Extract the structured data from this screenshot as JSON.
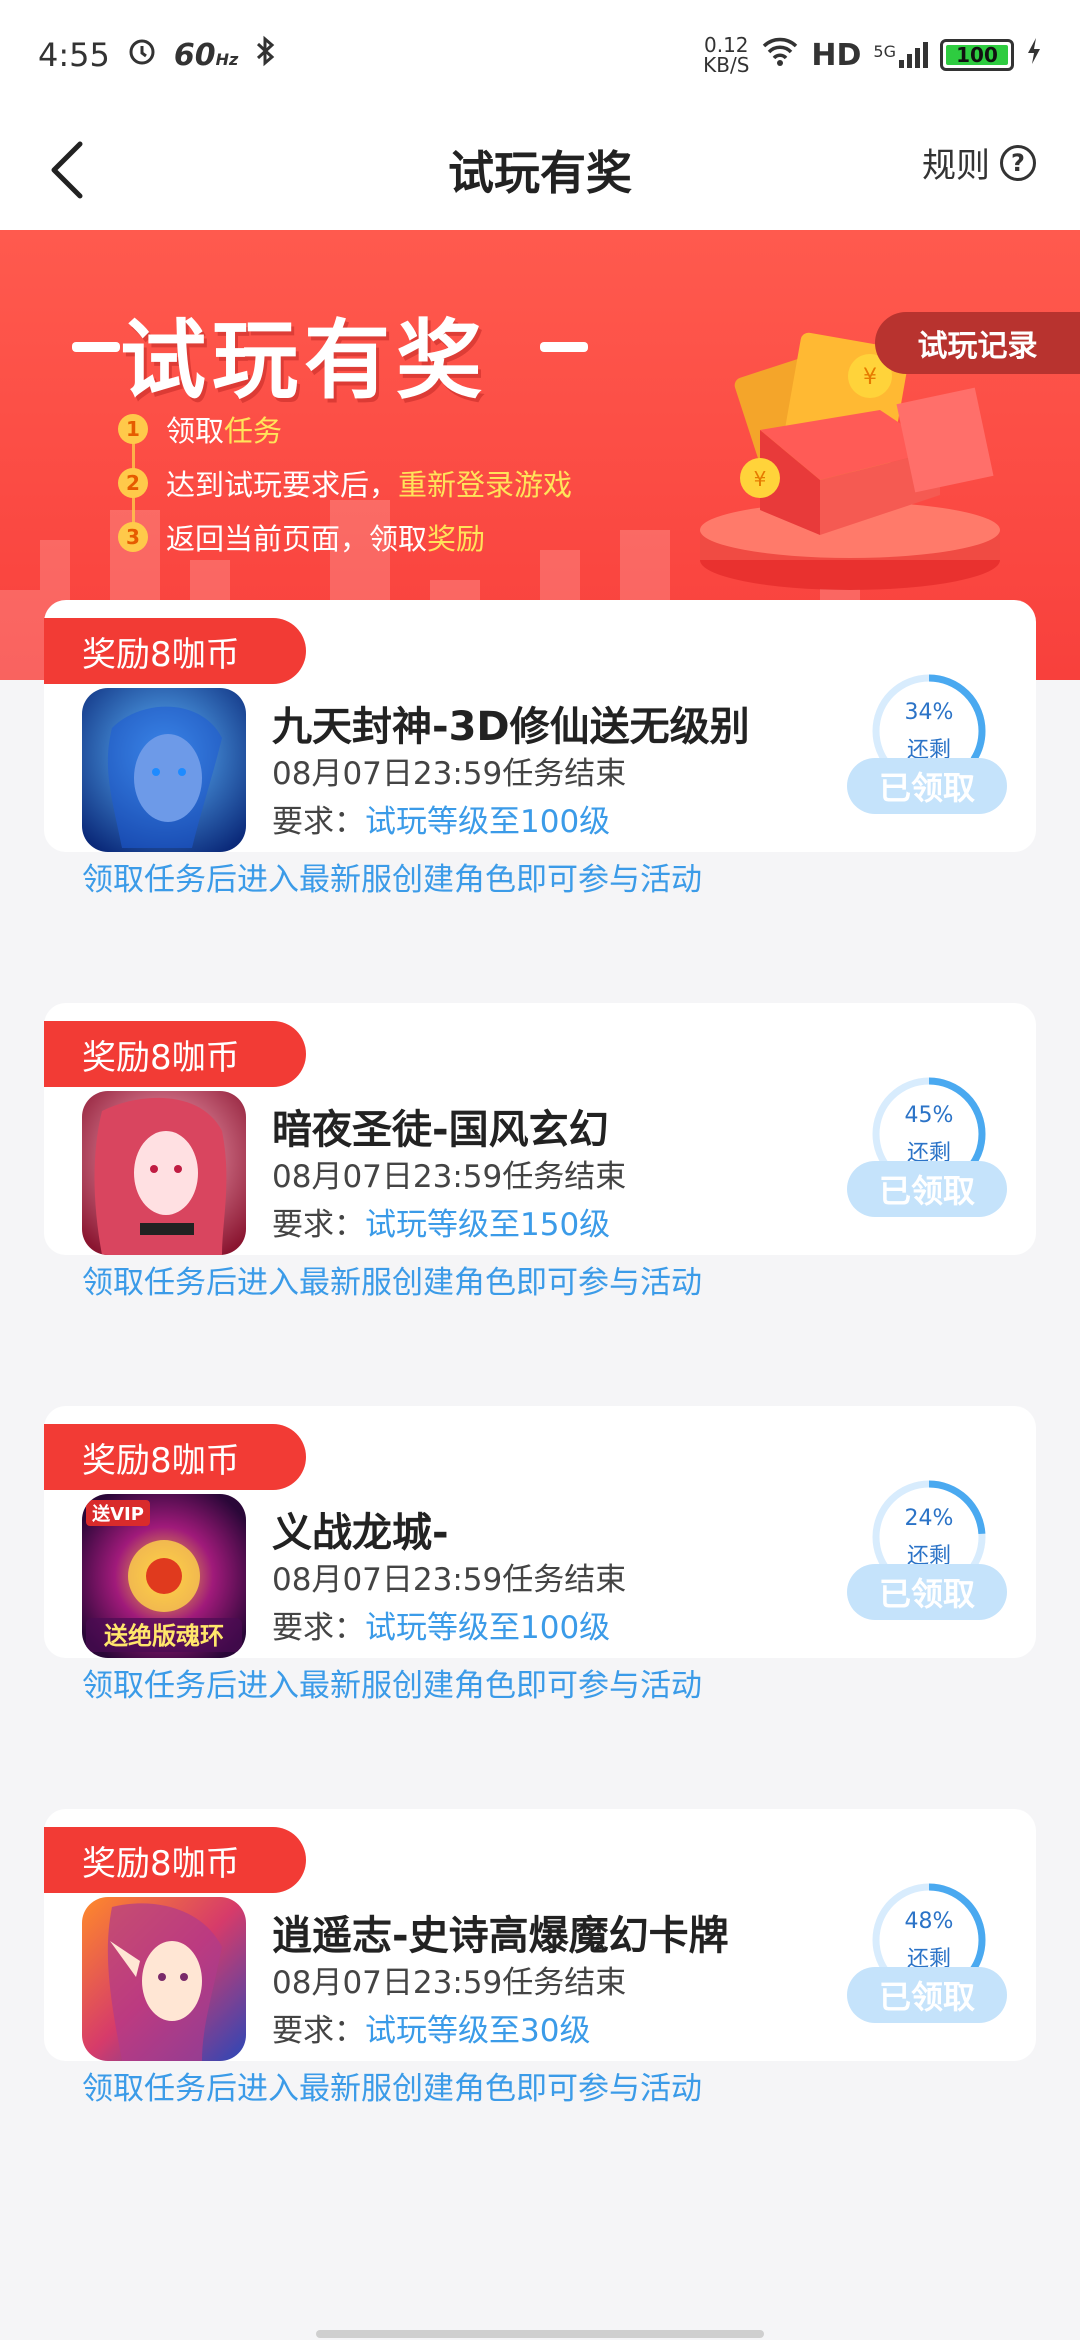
{
  "status_bar": {
    "time": "4:55",
    "refresh": "60",
    "refresh_unit": "Hz",
    "net_speed_value": "0.12",
    "net_speed_unit": "KB/S",
    "hd": "HD",
    "network": "5G",
    "battery": "100"
  },
  "header": {
    "title": "试玩有奖",
    "rules_label": "规则",
    "help_symbol": "?"
  },
  "banner": {
    "title": "试玩有奖",
    "record_button": "试玩记录",
    "steps": [
      {
        "num": "1",
        "text": "领取",
        "highlight": "任务"
      },
      {
        "num": "2",
        "text": "达到试玩要求后，",
        "highlight": "重新登录游戏"
      },
      {
        "num": "3",
        "text": "返回当前页面，领取",
        "highlight": "奖励"
      }
    ]
  },
  "tasks": [
    {
      "reward": "奖励8咖币",
      "name": "九天封神-3D修仙送无级别",
      "deadline": "08月07日23:59任务结束",
      "req_label": "要求：",
      "req_value": "试玩等级至100级",
      "hint": "领取任务后进入最新服创建角色即可参与活动",
      "percent_text": "34%",
      "percent": 0.34,
      "remain": "还剩",
      "status": "已领取"
    },
    {
      "reward": "奖励8咖币",
      "name": "暗夜圣徒-国风玄幻",
      "deadline": "08月07日23:59任务结束",
      "req_label": "要求：",
      "req_value": "试玩等级至150级",
      "hint": "领取任务后进入最新服创建角色即可参与活动",
      "percent_text": "45%",
      "percent": 0.45,
      "remain": "还剩",
      "status": "已领取"
    },
    {
      "reward": "奖励8咖币",
      "name": "义战龙城-",
      "deadline": "08月07日23:59任务结束",
      "req_label": "要求：",
      "req_value": "试玩等级至100级",
      "hint": "领取任务后进入最新服创建角色即可参与活动",
      "percent_text": "24%",
      "percent": 0.24,
      "remain": "还剩",
      "status": "已领取",
      "icon_text_top": "送VIP",
      "icon_text_bottom": "送绝版魂环"
    },
    {
      "reward": "奖励8咖币",
      "name": "逍遥志-史诗高爆魔幻卡牌",
      "deadline": "08月07日23:59任务结束",
      "req_label": "要求：",
      "req_value": "试玩等级至30级",
      "hint": "领取任务后进入最新服创建角色即可参与活动",
      "percent_text": "48%",
      "percent": 0.48,
      "remain": "还剩",
      "status": "已领取"
    }
  ]
}
